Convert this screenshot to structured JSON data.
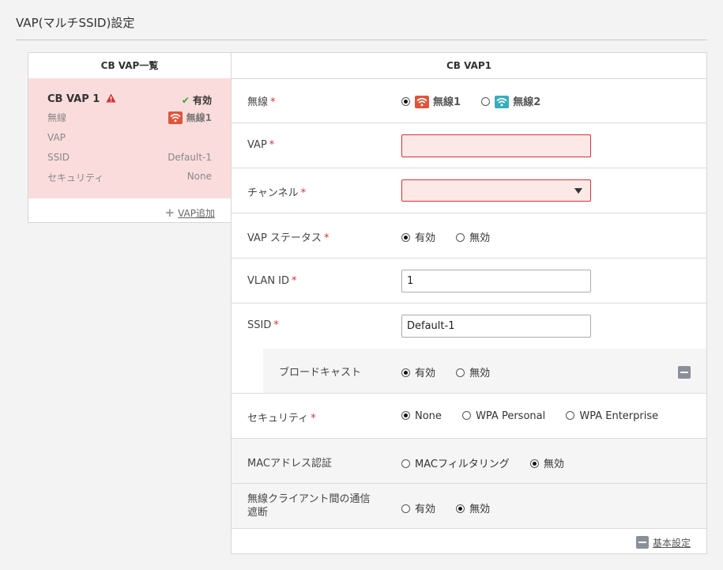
{
  "page": {
    "title": "VAP(マルチSSID)設定"
  },
  "left": {
    "header": "CB VAP一覧",
    "card": {
      "name": "CB VAP 1",
      "status": "有効",
      "rows": [
        {
          "label": "無線",
          "value": "無線1"
        },
        {
          "label": "VAP",
          "value": ""
        },
        {
          "label": "SSID",
          "value": "Default-1"
        },
        {
          "label": "セキュリティ",
          "value": "None"
        }
      ]
    },
    "add_link": "VAP追加"
  },
  "right": {
    "header": "CB VAP1",
    "radio_row": {
      "label": "無線",
      "options": [
        "無線1",
        "無線2"
      ],
      "selected": "無線1"
    },
    "vap_row": {
      "label": "VAP",
      "value": ""
    },
    "channel_row": {
      "label": "チャンネル",
      "value": ""
    },
    "status_row": {
      "label": "VAP ステータス",
      "options": [
        "有効",
        "無効"
      ],
      "selected": "有効"
    },
    "vlan_row": {
      "label": "VLAN ID",
      "value": "1"
    },
    "ssid_row": {
      "label": "SSID",
      "value": "Default-1"
    },
    "broadcast_row": {
      "label": "ブロードキャスト",
      "options": [
        "有効",
        "無効"
      ],
      "selected": "有効"
    },
    "security_row": {
      "label": "セキュリティ",
      "options": [
        "None",
        "WPA Personal",
        "WPA Enterprise"
      ],
      "selected": "None"
    },
    "mac_row": {
      "label": "MACアドレス認証",
      "options": [
        "MACフィルタリング",
        "無効"
      ],
      "selected": "無効"
    },
    "isolation_row": {
      "label_line1": "無線クライアント間の通信",
      "label_line2": "遮断",
      "options": [
        "有効",
        "無効"
      ],
      "selected": "無効"
    },
    "footer_link": "基本設定"
  },
  "colors": {
    "error": "#d23232",
    "card_bg": "#fbdcdc",
    "wifi1": "#e0553a",
    "wifi2": "#38aebd",
    "ok": "#3aa23a"
  }
}
